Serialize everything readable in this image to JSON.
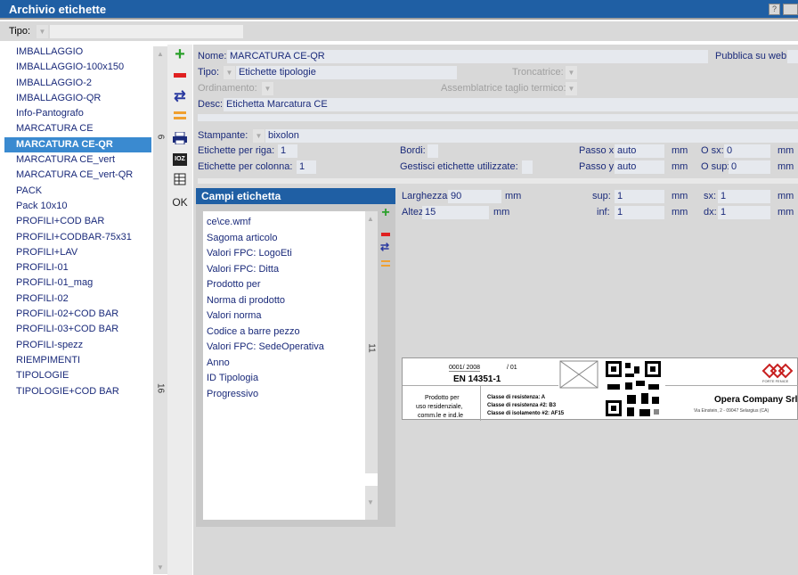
{
  "window": {
    "title": "Archivio etichette",
    "help_label": "?"
  },
  "filter": {
    "tipo_label": "Tipo:",
    "tipo_value": ""
  },
  "list": {
    "items": [
      "IMBALLAGGIO",
      "IMBALLAGGIO-100x150",
      "IMBALLAGGIO-2",
      "IMBALLAGGIO-QR",
      "Info-Pantografo",
      "MARCATURA CE",
      "MARCATURA CE-QR",
      "MARCATURA CE_vert",
      "MARCATURA CE_vert-QR",
      "PACK",
      "Pack 10x10",
      "PROFILI+COD BAR",
      "PROFILI+CODBAR-75x31",
      "PROFILI+LAV",
      "PROFILI-01",
      "PROFILI-01_mag",
      "PROFILI-02",
      "PROFILI-02+COD BAR",
      "PROFILI-03+COD BAR",
      "PROFILI-spezz",
      "RIEMPIMENTI",
      "TIPOLOGIE",
      "TIPOLOGIE+COD BAR"
    ],
    "selected_index": 6,
    "scroll_count_top": "6",
    "scroll_count_bottom": "16"
  },
  "toolbar": {
    "ok_label": "OK",
    "zoom_label": "IOZ"
  },
  "form": {
    "nome_label": "Nome:",
    "nome_value": "MARCATURA CE-QR",
    "pubblica_label": "Pubblica su web:",
    "tipo_label": "Tipo:",
    "tipo_value": "Etichette tipologie",
    "troncatrice_label": "Troncatrice:",
    "ordinamento_label": "Ordinamento:",
    "assemblatrice_label": "Assemblatrice taglio termico:",
    "desc_label": "Desc:",
    "desc_value": "Etichetta Marcatura CE",
    "stampante_label": "Stampante:",
    "stampante_value": "bixolon",
    "per_riga_label": "Etichette per riga:",
    "per_riga_value": "1",
    "per_colonna_label": "Etichette per colonna:",
    "per_colonna_value": "1",
    "bordi_label": "Bordi:",
    "gestisci_label": "Gestisci etichette utilizzate:",
    "passo_x_label": "Passo x:",
    "passo_x_value": "auto",
    "passo_y_label": "Passo y:",
    "passo_y_value": "auto",
    "unit_mm": "mm",
    "osx_label": "O sx:",
    "osx_value": "0",
    "osup_label": "O sup:",
    "osup_value": "0",
    "larghezza_label": "Larghezza:",
    "larghezza_value": "90",
    "altezza_label": "Altezza:",
    "altezza_value": "15",
    "sup_label": "sup:",
    "sup_value": "1",
    "inf_label": "inf:",
    "inf_value": "1",
    "sx_label": "sx:",
    "sx_value": "1",
    "dx_label": "dx:",
    "dx_value": "1"
  },
  "campi": {
    "title": "Campi etichetta",
    "items": [
      "ce\\ce.wmf",
      "Sagoma articolo",
      "Valori FPC: LogoEti",
      "Valori FPC: Ditta",
      "Prodotto per",
      "Norma di prodotto",
      "Valori norma",
      "Codice a barre pezzo",
      "Valori FPC: SedeOperativa",
      "Anno",
      "ID Tipologia",
      "Progressivo"
    ],
    "count": "11"
  },
  "preview": {
    "number": "0001/ 2008",
    "suffix": "/ 01",
    "norm": "EN 14351-1",
    "prodotto_lines": [
      "Prodotto per",
      "uso residenziale,",
      "comm.le e ind.le"
    ],
    "classe_lines": [
      "Classe di resistenza: A",
      "Classe di resistenza #2: B3",
      "Classe di isolamento #2: AF15"
    ],
    "company": "Opera Company Srl",
    "address": "Via Einstein, 2 - 09047 Selargius (CA)",
    "logo_text": "FORTE FENICE"
  },
  "colors": {
    "title_bar": "#1f5fa4",
    "selected_row": "#3a8ad0",
    "add_green": "#2aa02a",
    "remove_red": "#e02020",
    "swap_blue": "#2a3aa0",
    "orange": "#f0a030",
    "logo_red": "#c82020"
  }
}
